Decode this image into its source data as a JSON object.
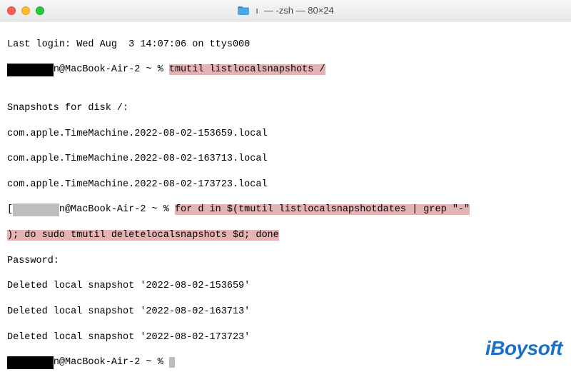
{
  "window": {
    "title": "— -zsh — 80×24",
    "title_prefix_glyph": "ı"
  },
  "terminal": {
    "last_login": "Last login: Wed Aug  3 14:07:06 on ttys000",
    "user_redacted1": "        ",
    "prompt_host": "n@MacBook-Air-2 ~ % ",
    "cmd1": "tmutil listlocalsnapshots /",
    "blank": "",
    "snapshots_header": "Snapshots for disk /:",
    "snap1": "com.apple.TimeMachine.2022-08-02-153659.local",
    "snap2": "com.apple.TimeMachine.2022-08-02-163713.local",
    "snap3": "com.apple.TimeMachine.2022-08-02-173723.local",
    "bracket_open": "[",
    "grayblock": "        ",
    "cmd2_part1": "for d in $(tmutil listlocalsnapshotdates | grep \"-\"",
    "cmd2_part2": "); do sudo tmutil deletelocalsnapshots $d; done",
    "password_label": "Password:",
    "deleted1": "Deleted local snapshot '2022-08-02-153659'",
    "deleted2": "Deleted local snapshot '2022-08-02-163713'",
    "deleted3": "Deleted local snapshot '2022-08-02-173723'",
    "final_prompt_space": " "
  },
  "brand": {
    "text": "iBoysoft"
  }
}
